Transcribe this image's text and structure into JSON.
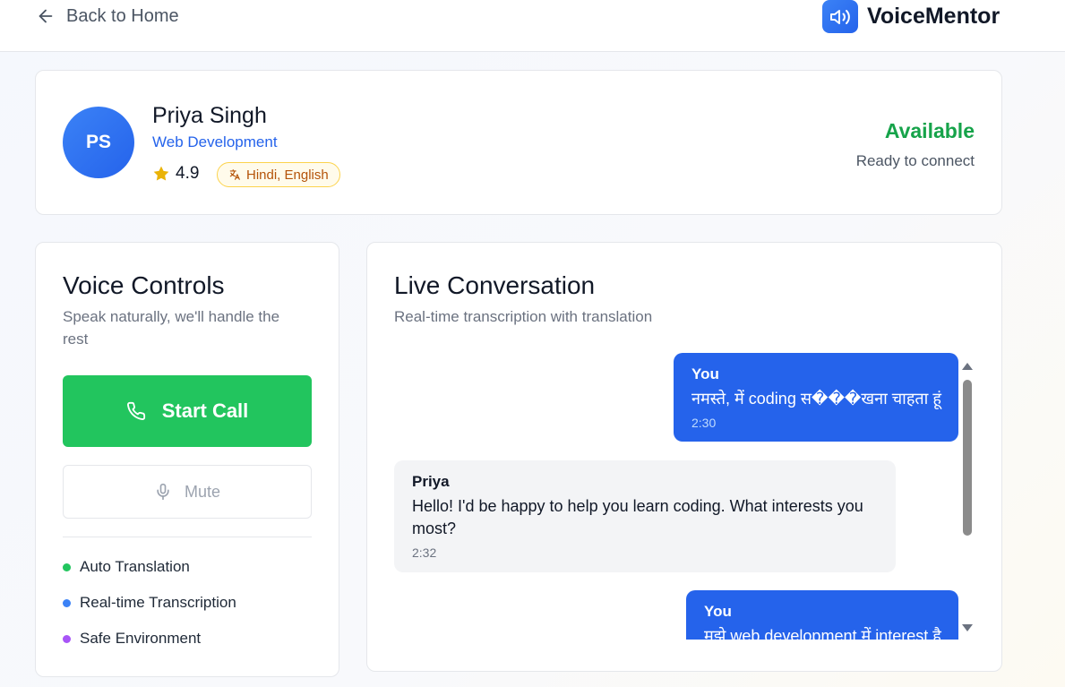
{
  "header": {
    "back_label": "Back to Home",
    "brand_name": "VoiceMentor"
  },
  "mentor": {
    "initials": "PS",
    "name": "Priya Singh",
    "field": "Web Development",
    "rating": "4.9",
    "languages": "Hindi, English",
    "status": "Available",
    "status_sub": "Ready to connect"
  },
  "controls": {
    "title": "Voice Controls",
    "subtitle": "Speak naturally, we'll handle the rest",
    "start_call_label": "Start Call",
    "mute_label": "Mute",
    "features": [
      {
        "label": "Auto Translation",
        "color": "#22c55e"
      },
      {
        "label": "Real-time Transcription",
        "color": "#3b82f6"
      },
      {
        "label": "Safe Environment",
        "color": "#a855f7"
      }
    ]
  },
  "conversation": {
    "title": "Live Conversation",
    "subtitle": "Real-time transcription with translation",
    "messages": [
      {
        "sender": "You",
        "text": "नमस्ते, में coding स���खना चाहता हूं",
        "time": "2:30"
      },
      {
        "sender": "Priya",
        "text": "Hello! I'd be happy to help you learn coding. What interests you most?",
        "time": "2:32"
      },
      {
        "sender": "You",
        "text": "मुझे web development में interest है",
        "time": ""
      }
    ]
  },
  "colors": {
    "primary": "#2563eb",
    "success": "#22c55e",
    "available": "#16a34a",
    "language_badge": "#b45309"
  }
}
